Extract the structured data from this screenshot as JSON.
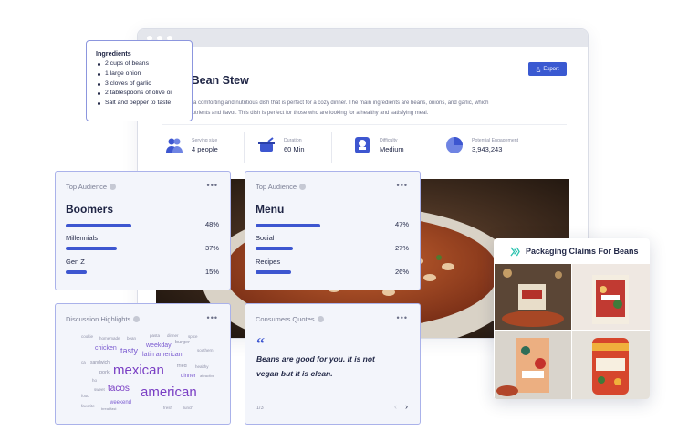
{
  "window": {
    "title": "ty Bean Stew",
    "export_label": "Export",
    "description_line1": "tew is a comforting and nutritious dish that is perfect for a cozy dinner. The main ingredients are beans, onions, and garlic, which",
    "description_line2": "with nutrients and flavor. This dish is perfect for those who are looking for a healthy and satisfying meal."
  },
  "stats": [
    {
      "label": "Serving size",
      "value": "4 people",
      "icon": "people-icon"
    },
    {
      "label": "Duration",
      "value": "60 Min",
      "icon": "pot-icon"
    },
    {
      "label": "Difficulty",
      "value": "Medium",
      "icon": "chef-hat-icon"
    },
    {
      "label": "Potential Engagement",
      "value": "3,943,243",
      "icon": "pie-chart-icon"
    }
  ],
  "ingredients": {
    "title": "Ingredients",
    "items": [
      "2 cups of beans",
      "1 large onion",
      "3 cloves of garlic",
      "2 tablespoons of olive oil",
      "Salt and pepper to taste"
    ]
  },
  "audience1": {
    "title": "Top Audience",
    "top": "Boomers",
    "rows": [
      {
        "label": "",
        "pct_text": "48%",
        "value": 0.48
      },
      {
        "label": "Millennials",
        "pct_text": "37%",
        "value": 0.37
      },
      {
        "label": "Gen Z",
        "pct_text": "15%",
        "value": 0.15
      }
    ]
  },
  "audience2": {
    "title": "Top Audience",
    "top": "Menu",
    "rows": [
      {
        "label": "",
        "pct_text": "47%",
        "value": 0.47
      },
      {
        "label": "Social",
        "pct_text": "27%",
        "value": 0.27
      },
      {
        "label": "Recipes",
        "pct_text": "26%",
        "value": 0.26
      }
    ]
  },
  "discussion": {
    "title": "Discussion Highlights",
    "words": [
      "cookie",
      "homemade",
      "bean",
      "pasta",
      "dinner",
      "spice",
      "weekday",
      "burger",
      "southern",
      "chicken",
      "tasty",
      "latin american",
      "ca",
      "sandwich",
      "fried",
      "healthy",
      "pork",
      "mexican",
      "dinner",
      "attractive",
      "ho",
      "tacos",
      "sweet",
      "american",
      "food",
      "weekend",
      "breakfast",
      "fresh",
      "favorite",
      "lunch"
    ]
  },
  "quotes": {
    "title": "Consumers Quotes",
    "quote_mark": "“",
    "text": "Beans are good for you. it is not vegan but it is clean.",
    "page": "1/3",
    "prev": "‹",
    "next": "›"
  },
  "packaging": {
    "title": "Packaging Claims For Beans"
  }
}
